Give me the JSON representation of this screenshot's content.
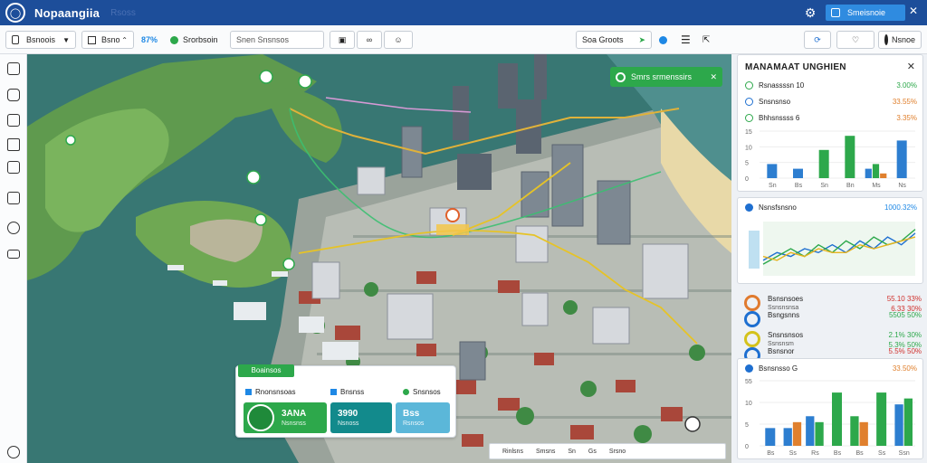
{
  "header": {
    "app_title": "Nopaangiia",
    "ghost_text": "Rsoss",
    "account_label": "Smeisnoie",
    "colors": {
      "bar": "#1d4e9a",
      "account": "#2f8be0"
    }
  },
  "toolbar": {
    "layer_select": "Bsnoois",
    "view_select": "Bsno",
    "stepper_value": "87%",
    "status_label": "Srorbsoin",
    "search_placeholder": "Snen Snsnsos",
    "layers_label": "Soa Groots",
    "account_name": "Nsnoe"
  },
  "map": {
    "route_chip": "Smrs srmenssirs",
    "chip_icons": [
      "globe-icon",
      "close-icon"
    ],
    "card": {
      "tag": "Boainsos",
      "cols": [
        {
          "label": "Rnonsnsoas",
          "value": "3ANA",
          "sub": "Nsnsnss",
          "color": "#2da84b"
        },
        {
          "label": "Bnsnss",
          "value": "3990",
          "sub": "Nsnoss",
          "color": "#128a8c"
        },
        {
          "label": "Snsnsos",
          "value": "Bss",
          "sub": "Rsnsos",
          "color": "#5bb7d9"
        }
      ]
    },
    "legend": [
      "Rinlsns",
      "Smsns",
      "Sn",
      "Gs",
      "Srsno"
    ]
  },
  "panel": {
    "title": "MANAMAAT UNGHIEN",
    "rows": [
      {
        "label": "Rsnassssn 10",
        "value": "3.00%",
        "color": "#2da84b"
      },
      {
        "label": "Snsnsnso",
        "value": "33.55%",
        "color": "#e0802e"
      },
      {
        "label": "Bhhsnssss 6",
        "value": "3.35%",
        "color": "#2da84b"
      }
    ],
    "chart1": {
      "y_ticks": [
        "15",
        "10",
        "5",
        "0"
      ],
      "x_labels": [
        "Sn",
        "Bs",
        "Sn",
        "Bn",
        "Ms",
        "Ns"
      ]
    },
    "chart2": {
      "label": "Nsnsfsnsno",
      "value": "1000.32%",
      "colors": {
        "value": "#1e88e5"
      }
    },
    "metrics": [
      {
        "label": "Bsnsnsoes",
        "sub": "Ssnsnsnsa",
        "value": "55.10 33%",
        "value2": "6.33 30%",
        "ring": "#e07a2e",
        "valcolor": "#d0312d"
      },
      {
        "label": "Bsngsnns",
        "sub": "",
        "value": "5505 50%",
        "value2": "",
        "ring": "#1e6fd0",
        "valcolor": "#2da84b"
      },
      {
        "label": "Snsnsnsos",
        "sub": "Ssnsnsm",
        "value": "2.1% 30%",
        "value2": "5.3% 50%",
        "ring": "#d4c21c",
        "valcolor": "#2da84b"
      },
      {
        "label": "Bsnsnor",
        "sub": "",
        "value": "5.5% 50%",
        "value2": "",
        "ring": "#1e6fd0",
        "valcolor": "#d0312d"
      }
    ],
    "chart3": {
      "label": "Bsnsnsso G",
      "value": "33.50%",
      "y_ticks": [
        "55",
        "10",
        "5",
        "0"
      ],
      "x_labels": [
        "Bs",
        "Ss",
        "Rs",
        "Bs",
        "Bs",
        "Ss",
        "Ssn"
      ]
    }
  },
  "chart_data": [
    {
      "type": "bar",
      "categories": [
        "Sn",
        "Bs",
        "Sn",
        "Bn",
        "Ms",
        "Ns"
      ],
      "series": [
        {
          "color": "#2d7ed0",
          "values": [
            3,
            2,
            0,
            0,
            2,
            8
          ]
        },
        {
          "color": "#2da84b",
          "values": [
            0,
            0,
            6,
            9,
            3,
            0
          ]
        },
        {
          "color": "#e0802e",
          "values": [
            0,
            0,
            0,
            0,
            1,
            0
          ]
        }
      ],
      "ylim": [
        0,
        10
      ],
      "y_ticks": [
        "15",
        "10",
        "5",
        "0"
      ]
    },
    {
      "type": "line",
      "title": "Nsnsfsnsno",
      "series": [
        {
          "color": "#1e6fd0",
          "values": [
            4,
            6,
            5,
            7,
            6,
            8,
            6,
            9,
            7,
            10,
            8,
            11
          ]
        },
        {
          "color": "#2da84b",
          "values": [
            3,
            5,
            7,
            5,
            8,
            6,
            9,
            7,
            10,
            8,
            9,
            12
          ]
        },
        {
          "color": "#e6b31e",
          "values": [
            5,
            4,
            6,
            5,
            7,
            6,
            6,
            8,
            7,
            8,
            9,
            10
          ]
        }
      ],
      "ylim": [
        0,
        14
      ]
    },
    {
      "type": "bar",
      "title": "Bsnsnsso G",
      "categories": [
        "Bs",
        "Ss",
        "Rs",
        "Bs",
        "Bs",
        "Ss",
        "Ssn"
      ],
      "series": [
        {
          "color": "#2d7ed0",
          "values": [
            3,
            3,
            5,
            0,
            0,
            0,
            7
          ]
        },
        {
          "color": "#2da84b",
          "values": [
            0,
            0,
            4,
            9,
            5,
            9,
            8
          ]
        },
        {
          "color": "#e0802e",
          "values": [
            0,
            4,
            0,
            0,
            4,
            0,
            0
          ]
        }
      ],
      "ylim": [
        0,
        11
      ],
      "y_ticks": [
        "55",
        "10",
        "5",
        "0"
      ]
    }
  ]
}
